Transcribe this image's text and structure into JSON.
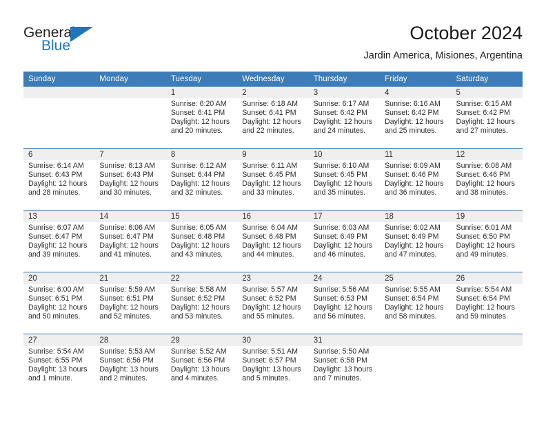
{
  "brand": {
    "name_top": "General",
    "name_bottom": "Blue",
    "color_dark": "#231f20",
    "color_blue": "#1f76bc"
  },
  "header": {
    "title": "October 2024",
    "subtitle": "Jardin America, Misiones, Argentina"
  },
  "theme": {
    "header_bar": "#3c7cb8",
    "row_divider": "#2f6fa8",
    "daynum_band": "#efefef"
  },
  "weekday_headers": [
    "Sunday",
    "Monday",
    "Tuesday",
    "Wednesday",
    "Thursday",
    "Friday",
    "Saturday"
  ],
  "weeks": [
    [
      {
        "day": "",
        "sunrise": "",
        "sunset": "",
        "daylight": ""
      },
      {
        "day": "",
        "sunrise": "",
        "sunset": "",
        "daylight": ""
      },
      {
        "day": "1",
        "sunrise": "Sunrise: 6:20 AM",
        "sunset": "Sunset: 6:41 PM",
        "daylight": "Daylight: 12 hours and 20 minutes."
      },
      {
        "day": "2",
        "sunrise": "Sunrise: 6:18 AM",
        "sunset": "Sunset: 6:41 PM",
        "daylight": "Daylight: 12 hours and 22 minutes."
      },
      {
        "day": "3",
        "sunrise": "Sunrise: 6:17 AM",
        "sunset": "Sunset: 6:42 PM",
        "daylight": "Daylight: 12 hours and 24 minutes."
      },
      {
        "day": "4",
        "sunrise": "Sunrise: 6:16 AM",
        "sunset": "Sunset: 6:42 PM",
        "daylight": "Daylight: 12 hours and 25 minutes."
      },
      {
        "day": "5",
        "sunrise": "Sunrise: 6:15 AM",
        "sunset": "Sunset: 6:42 PM",
        "daylight": "Daylight: 12 hours and 27 minutes."
      }
    ],
    [
      {
        "day": "6",
        "sunrise": "Sunrise: 6:14 AM",
        "sunset": "Sunset: 6:43 PM",
        "daylight": "Daylight: 12 hours and 28 minutes."
      },
      {
        "day": "7",
        "sunrise": "Sunrise: 6:13 AM",
        "sunset": "Sunset: 6:43 PM",
        "daylight": "Daylight: 12 hours and 30 minutes."
      },
      {
        "day": "8",
        "sunrise": "Sunrise: 6:12 AM",
        "sunset": "Sunset: 6:44 PM",
        "daylight": "Daylight: 12 hours and 32 minutes."
      },
      {
        "day": "9",
        "sunrise": "Sunrise: 6:11 AM",
        "sunset": "Sunset: 6:45 PM",
        "daylight": "Daylight: 12 hours and 33 minutes."
      },
      {
        "day": "10",
        "sunrise": "Sunrise: 6:10 AM",
        "sunset": "Sunset: 6:45 PM",
        "daylight": "Daylight: 12 hours and 35 minutes."
      },
      {
        "day": "11",
        "sunrise": "Sunrise: 6:09 AM",
        "sunset": "Sunset: 6:46 PM",
        "daylight": "Daylight: 12 hours and 36 minutes."
      },
      {
        "day": "12",
        "sunrise": "Sunrise: 6:08 AM",
        "sunset": "Sunset: 6:46 PM",
        "daylight": "Daylight: 12 hours and 38 minutes."
      }
    ],
    [
      {
        "day": "13",
        "sunrise": "Sunrise: 6:07 AM",
        "sunset": "Sunset: 6:47 PM",
        "daylight": "Daylight: 12 hours and 39 minutes."
      },
      {
        "day": "14",
        "sunrise": "Sunrise: 6:06 AM",
        "sunset": "Sunset: 6:47 PM",
        "daylight": "Daylight: 12 hours and 41 minutes."
      },
      {
        "day": "15",
        "sunrise": "Sunrise: 6:05 AM",
        "sunset": "Sunset: 6:48 PM",
        "daylight": "Daylight: 12 hours and 43 minutes."
      },
      {
        "day": "16",
        "sunrise": "Sunrise: 6:04 AM",
        "sunset": "Sunset: 6:48 PM",
        "daylight": "Daylight: 12 hours and 44 minutes."
      },
      {
        "day": "17",
        "sunrise": "Sunrise: 6:03 AM",
        "sunset": "Sunset: 6:49 PM",
        "daylight": "Daylight: 12 hours and 46 minutes."
      },
      {
        "day": "18",
        "sunrise": "Sunrise: 6:02 AM",
        "sunset": "Sunset: 6:49 PM",
        "daylight": "Daylight: 12 hours and 47 minutes."
      },
      {
        "day": "19",
        "sunrise": "Sunrise: 6:01 AM",
        "sunset": "Sunset: 6:50 PM",
        "daylight": "Daylight: 12 hours and 49 minutes."
      }
    ],
    [
      {
        "day": "20",
        "sunrise": "Sunrise: 6:00 AM",
        "sunset": "Sunset: 6:51 PM",
        "daylight": "Daylight: 12 hours and 50 minutes."
      },
      {
        "day": "21",
        "sunrise": "Sunrise: 5:59 AM",
        "sunset": "Sunset: 6:51 PM",
        "daylight": "Daylight: 12 hours and 52 minutes."
      },
      {
        "day": "22",
        "sunrise": "Sunrise: 5:58 AM",
        "sunset": "Sunset: 6:52 PM",
        "daylight": "Daylight: 12 hours and 53 minutes."
      },
      {
        "day": "23",
        "sunrise": "Sunrise: 5:57 AM",
        "sunset": "Sunset: 6:52 PM",
        "daylight": "Daylight: 12 hours and 55 minutes."
      },
      {
        "day": "24",
        "sunrise": "Sunrise: 5:56 AM",
        "sunset": "Sunset: 6:53 PM",
        "daylight": "Daylight: 12 hours and 56 minutes."
      },
      {
        "day": "25",
        "sunrise": "Sunrise: 5:55 AM",
        "sunset": "Sunset: 6:54 PM",
        "daylight": "Daylight: 12 hours and 58 minutes."
      },
      {
        "day": "26",
        "sunrise": "Sunrise: 5:54 AM",
        "sunset": "Sunset: 6:54 PM",
        "daylight": "Daylight: 12 hours and 59 minutes."
      }
    ],
    [
      {
        "day": "27",
        "sunrise": "Sunrise: 5:54 AM",
        "sunset": "Sunset: 6:55 PM",
        "daylight": "Daylight: 13 hours and 1 minute."
      },
      {
        "day": "28",
        "sunrise": "Sunrise: 5:53 AM",
        "sunset": "Sunset: 6:56 PM",
        "daylight": "Daylight: 13 hours and 2 minutes."
      },
      {
        "day": "29",
        "sunrise": "Sunrise: 5:52 AM",
        "sunset": "Sunset: 6:56 PM",
        "daylight": "Daylight: 13 hours and 4 minutes."
      },
      {
        "day": "30",
        "sunrise": "Sunrise: 5:51 AM",
        "sunset": "Sunset: 6:57 PM",
        "daylight": "Daylight: 13 hours and 5 minutes."
      },
      {
        "day": "31",
        "sunrise": "Sunrise: 5:50 AM",
        "sunset": "Sunset: 6:58 PM",
        "daylight": "Daylight: 13 hours and 7 minutes."
      },
      {
        "day": "",
        "sunrise": "",
        "sunset": "",
        "daylight": ""
      },
      {
        "day": "",
        "sunrise": "",
        "sunset": "",
        "daylight": ""
      }
    ]
  ]
}
